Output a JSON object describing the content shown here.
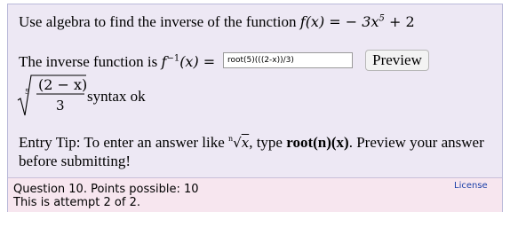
{
  "question": {
    "prompt_text": "Use algebra to find the inverse of the function",
    "function_lhs": "f(x) =",
    "function_rhs_coef": "− 3x",
    "function_rhs_exp": "5",
    "function_rhs_tail": " + 2",
    "answer_label_pre": "The inverse function is ",
    "answer_label_f": "f",
    "answer_label_sup": "−1",
    "answer_label_post": "(x) =",
    "answer_value": "root(5)(((2-x))/3)",
    "preview_label": "Preview"
  },
  "preview": {
    "root_index": "5",
    "numerator": "(2 − x)",
    "denominator": "3",
    "status": "syntax ok"
  },
  "tip": {
    "line1_pre": "Entry Tip: To enter an answer like ",
    "example_index": "n",
    "example_var": "x",
    "line1_mid": ",  type ",
    "code": "root(n)(x)",
    "line1_post": ". Preview your answer",
    "line2": "before submitting!"
  },
  "info": {
    "points_line": "Question 10. Points possible: 10",
    "attempt_line": "This is attempt 2 of 2.",
    "license_label": "License"
  }
}
